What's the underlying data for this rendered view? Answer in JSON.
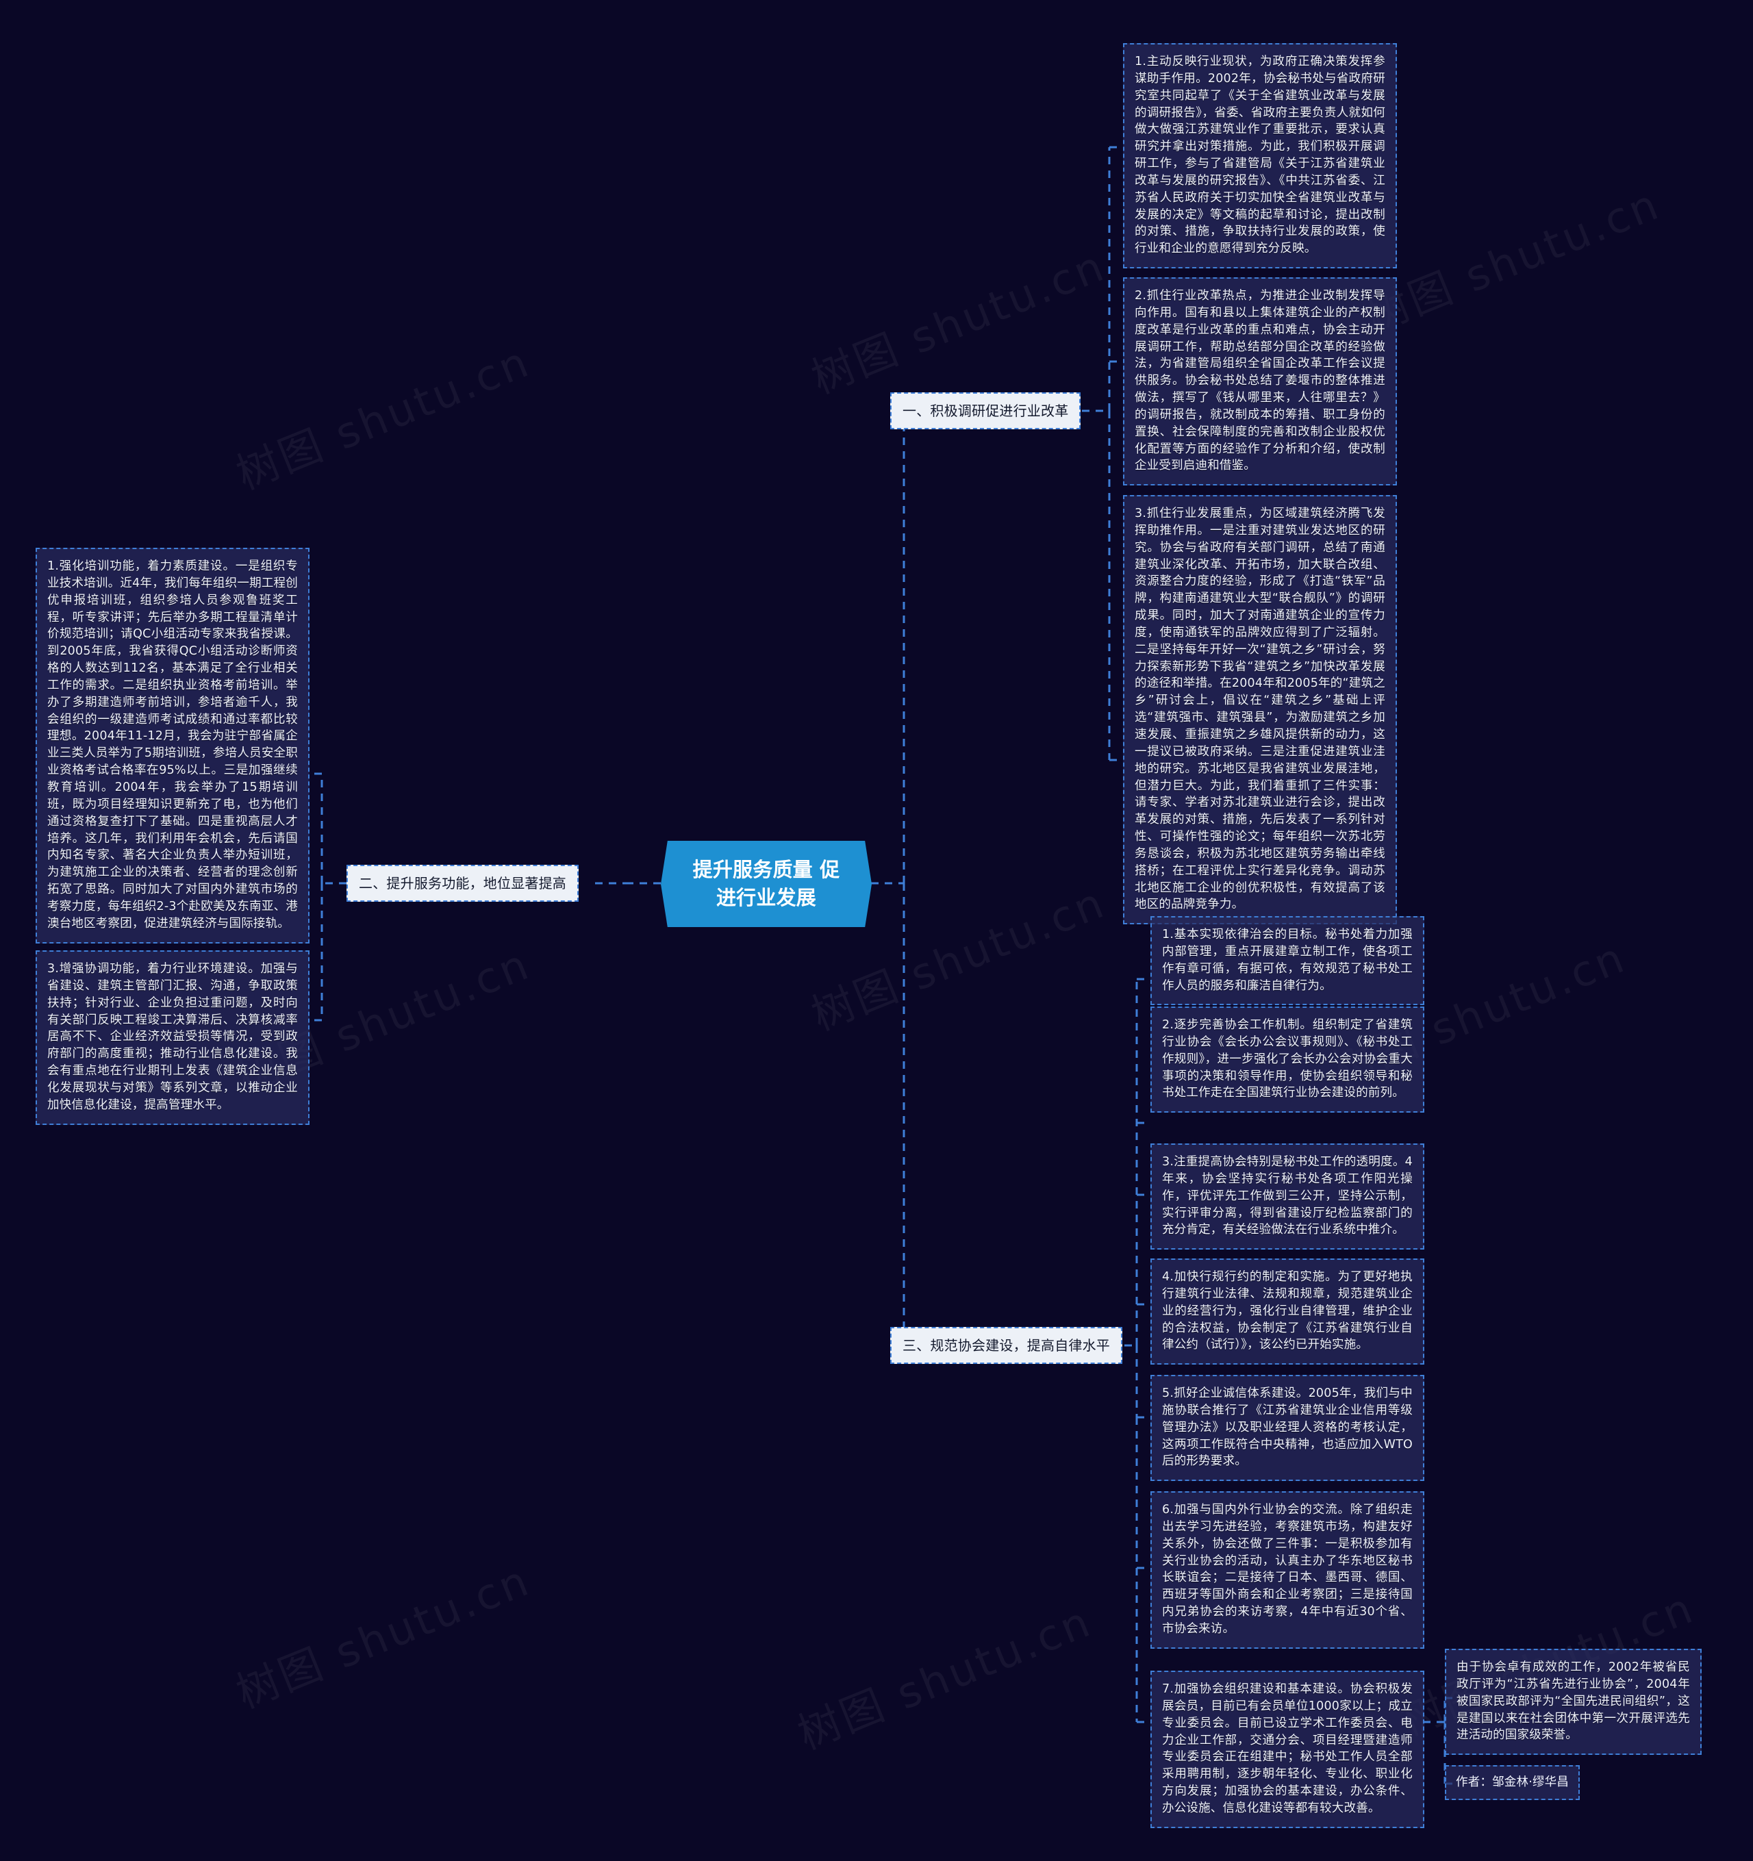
{
  "page": {
    "background_color": "#0a0726",
    "accent_color": "#1e90d2",
    "node_border_color": "#3f7fd8",
    "watermark_text": "树图 shutu.cn"
  },
  "root": {
    "label": "提升服务质量 促进行业发展"
  },
  "branches": [
    {
      "id": "b1",
      "label": "一、积极调研促进行业改革"
    },
    {
      "id": "b2",
      "label": "二、提升服务功能，地位显著提高"
    },
    {
      "id": "b3",
      "label": "三、规范协会建设，提高自律水平"
    }
  ],
  "branch1_items": [
    {
      "text": "1.主动反映行业现状，为政府正确决策发挥参谋助手作用。2002年，协会秘书处与省政府研究室共同起草了《关于全省建筑业改革与发展的调研报告》，省委、省政府主要负责人就如何做大做强江苏建筑业作了重要批示，要求认真研究并拿出对策措施。为此，我们积极开展调研工作，参与了省建管局《关于江苏省建筑业改革与发展的研究报告》、《中共江苏省委、江苏省人民政府关于切实加快全省建筑业改革与发展的决定》等文稿的起草和讨论，提出改制的对策、措施，争取扶持行业发展的政策，使行业和企业的意愿得到充分反映。"
    },
    {
      "text": "2.抓住行业改革热点，为推进企业改制发挥导向作用。国有和县以上集体建筑企业的产权制度改革是行业改革的重点和难点，协会主动开展调研工作，帮助总结部分国企改革的经验做法，为省建管局组织全省国企改革工作会议提供服务。协会秘书处总结了姜堰市的整体推进做法，撰写了《钱从哪里来，人往哪里去？》的调研报告，就改制成本的筹措、职工身份的置换、社会保障制度的完善和改制企业股权优化配置等方面的经验作了分析和介绍，使改制企业受到启迪和借鉴。"
    },
    {
      "text": "3.抓住行业发展重点，为区域建筑经济腾飞发挥助推作用。一是注重对建筑业发达地区的研究。协会与省政府有关部门调研，总结了南通建筑业深化改革、开拓市场，加大联合改组、资源整合力度的经验，形成了《打造“铁军”品牌，构建南通建筑业大型“联合舰队”》的调研成果。同时，加大了对南通建筑企业的宣传力度，使南通铁军的品牌效应得到了广泛辐射。二是坚持每年开好一次“建筑之乡”研讨会，努力探索新形势下我省“建筑之乡”加快改革发展的途径和举措。在2004年和2005年的“建筑之乡”研讨会上，倡议在“建筑之乡”基础上评选“建筑强市、建筑强县”，为激励建筑之乡加速发展、重振建筑之乡雄风提供新的动力，这一提议已被政府采纳。三是注重促进建筑业洼地的研究。苏北地区是我省建筑业发展洼地，但潜力巨大。为此，我们着重抓了三件实事：请专家、学者对苏北建筑业进行会诊，提出改革发展的对策、措施，先后发表了一系列针对性、可操作性强的论文；每年组织一次苏北劳务恳谈会，积极为苏北地区建筑劳务输出牵线搭桥；在工程评优上实行差异化竞争。调动苏北地区施工企业的创优积极性，有效提高了该地区的品牌竞争力。"
    }
  ],
  "branch2_items": [
    {
      "text": "1.强化培训功能，着力素质建设。一是组织专业技术培训。近4年，我们每年组织一期工程创优申报培训班，组织参培人员参观鲁班奖工程，听专家讲评；先后举办多期工程量清单计价规范培训；请QC小组活动专家来我省授课。到2005年底，我省获得QC小组活动诊断师资格的人数达到112名，基本满足了全行业相关工作的需求。二是组织执业资格考前培训。举办了多期建造师考前培训，参培者逾千人，我会组织的一级建造师考试成绩和通过率都比较理想。2004年11-12月，我会为驻宁部省属企业三类人员举为了5期培训班，参培人员安全职业资格考试合格率在95%以上。三是加强继续教育培训。2004年，我会举办了15期培训班，既为项目经理知识更新充了电，也为他们通过资格复查打下了基础。四是重视高层人才培养。这几年，我们利用年会机会，先后请国内知名专家、著名大企业负责人举办短训班，为建筑施工企业的决策者、经营者的理念创新拓宽了思路。同时加大了对国内外建筑市场的考察力度，每年组织2-3个赴欧美及东南亚、港澳台地区考察团，促进建筑经济与国际接轨。"
    },
    {
      "text": "3.增强协调功能，着力行业环境建设。加强与省建设、建筑主管部门汇报、沟通，争取政策扶持；针对行业、企业负担过重问题，及时向有关部门反映工程竣工决算滞后、决算核减率居高不下、企业经济效益受损等情况，受到政府部门的高度重视；推动行业信息化建设。我会有重点地在行业期刊上发表《建筑企业信息化发展现状与对策》等系列文章，以推动企业加快信息化建设，提高管理水平。"
    }
  ],
  "branch3_items": [
    {
      "text": "1.基本实现依律治会的目标。秘书处着力加强内部管理，重点开展建章立制工作，使各项工作有章可循，有据可依，有效规范了秘书处工作人员的服务和廉洁自律行为。"
    },
    {
      "text": "2.逐步完善协会工作机制。组织制定了省建筑行业协会《会长办公会议事规则》、《秘书处工作规则》，进一步强化了会长办公会对协会重大事项的决策和领导作用，使协会组织领导和秘书处工作走在全国建筑行业协会建设的前列。"
    },
    {
      "text": "3.注重提高协会特别是秘书处工作的透明度。4年来，协会坚持实行秘书处各项工作阳光操作，评优评先工作做到三公开，坚持公示制，实行评审分离，得到省建设厅纪检监察部门的充分肯定，有关经验做法在行业系统中推介。"
    },
    {
      "text": "4.加快行规行约的制定和实施。为了更好地执行建筑行业法律、法规和规章，规范建筑业企业的经营行为，强化行业自律管理，维护企业的合法权益，协会制定了《江苏省建筑行业自律公约（试行）》，该公约已开始实施。"
    },
    {
      "text": "5.抓好企业诚信体系建设。2005年，我们与中施协联合推行了《江苏省建筑业企业信用等级管理办法》以及职业经理人资格的考核认定，这两项工作既符合中央精神，也适应加入WTO后的形势要求。"
    },
    {
      "text": "6.加强与国内外行业协会的交流。除了组织走出去学习先进经验，考察建筑市场，构建友好关系外，协会还做了三件事：一是积极参加有关行业协会的活动，认真主办了华东地区秘书长联谊会；二是接待了日本、墨西哥、德国、西班牙等国外商会和企业考察团；三是接待国内兄弟协会的来访考察，4年中有近30个省、市协会来访。"
    },
    {
      "text": "7.加强协会组织建设和基本建设。协会积极发展会员，目前已有会员单位1000家以上；成立专业委员会。目前已设立学术工作委员会、电力企业工作部，交通分会、项目经理暨建造师专业委员会正在组建中；秘书处工作人员全部采用聘用制，逐步朝年轻化、专业化、职业化方向发展；加强协会的基本建设，办公条件、办公设施、信息化建设等都有较大改善。"
    }
  ],
  "honor": {
    "text": "由于协会卓有成效的工作，2002年被省民政厅评为“江苏省先进行业协会”，2004年被国家民政部评为“全国先进民间组织”，这是建国以来在社会团体中第一次开展评选先进活动的国家级荣誉。"
  },
  "credit": {
    "text": "作者：邹金林·缪华昌"
  }
}
